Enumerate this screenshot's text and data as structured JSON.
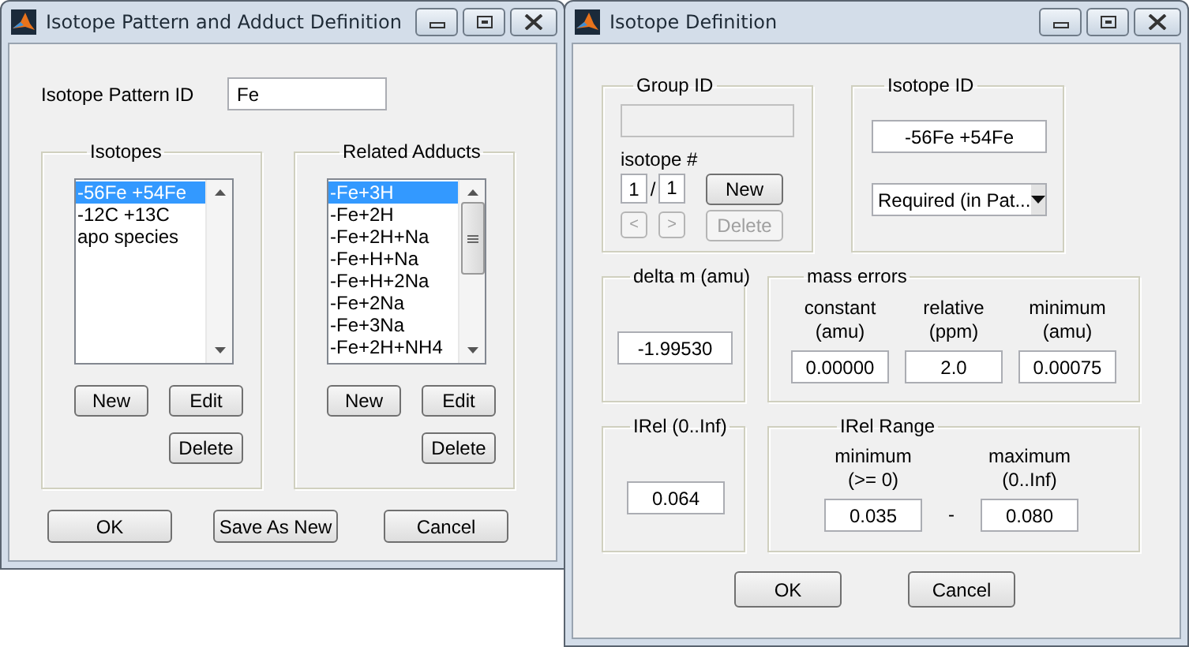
{
  "pattern_window": {
    "title": "Isotope Pattern and Adduct Definition",
    "pattern_id": {
      "label": "Isotope Pattern ID",
      "value": "Fe"
    },
    "lists": [
      {
        "title": "Isotopes",
        "items": [
          {
            "label": "-56Fe +54Fe",
            "selected": true
          },
          {
            "label": "-12C +13C",
            "selected": false
          },
          {
            "label": "apo species",
            "selected": false
          }
        ],
        "buttons": [
          "New",
          "Edit",
          "Delete"
        ]
      },
      {
        "title": "Related Adducts",
        "items": [
          {
            "label": "-Fe+3H",
            "selected": true
          },
          {
            "label": "-Fe+2H",
            "selected": false
          },
          {
            "label": "-Fe+2H+Na",
            "selected": false
          },
          {
            "label": "-Fe+H+Na",
            "selected": false
          },
          {
            "label": "-Fe+H+2Na",
            "selected": false
          },
          {
            "label": "-Fe+2Na",
            "selected": false
          },
          {
            "label": "-Fe+3Na",
            "selected": false
          },
          {
            "label": "-Fe+2H+NH4",
            "selected": false
          }
        ],
        "buttons": [
          "New",
          "Edit",
          "Delete"
        ]
      }
    ],
    "buttons": [
      "OK",
      "Save As New",
      "Cancel"
    ]
  },
  "isotope_window": {
    "title": "Isotope Definition",
    "group_id": {
      "title": "Group ID",
      "field": {
        "disabled": true
      },
      "isotope_label": "isotope #",
      "index": "1",
      "separator": "/",
      "total": "1",
      "new_button": {
        "label": "New",
        "disabled": false
      },
      "prev_button": {
        "label": "<",
        "disabled": true
      },
      "next_button": {
        "label": ">",
        "disabled": true
      },
      "delete_button": {
        "label": "Delete",
        "disabled": true
      }
    },
    "isotope_id": {
      "title": "Isotope ID",
      "value": "-56Fe +54Fe",
      "dropdown": {
        "value": "Required (in Pat..."
      }
    },
    "delta_m": {
      "title": "delta m (amu)",
      "value": "-1.99530"
    },
    "mass_errors": {
      "title": "mass errors",
      "columns": [
        {
          "label": "constant",
          "unit": "(amu)",
          "value": "0.00000"
        },
        {
          "label": "relative",
          "unit": "(ppm)",
          "value": "2.0"
        },
        {
          "label": "minimum",
          "unit": "(amu)",
          "value": "0.00075"
        }
      ]
    },
    "irel": {
      "title": "IRel (0..Inf)",
      "value": "0.064"
    },
    "irel_range": {
      "title": "IRel Range",
      "minimum": {
        "label": "minimum",
        "hint": "(>= 0)",
        "value": "0.035"
      },
      "separator": "-",
      "maximum": {
        "label": "maximum",
        "hint": "(0..Inf)",
        "value": "0.080"
      }
    },
    "buttons": [
      "OK",
      "Cancel"
    ]
  }
}
